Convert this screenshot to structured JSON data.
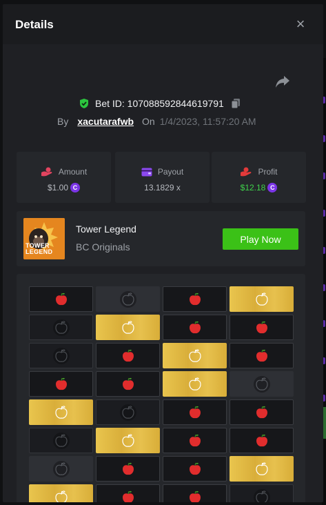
{
  "dialog": {
    "title": "Details",
    "close_glyph": "×"
  },
  "bet": {
    "id_text": "Bet ID: 107088592844619791",
    "by_label": "By",
    "username": "xacutarafwb",
    "on_label": "On",
    "datetime": "1/4/2023, 11:57:20 AM"
  },
  "stats": {
    "amount": {
      "label": "Amount",
      "value": "$1.00",
      "icon": "hand-coins-icon"
    },
    "payout": {
      "label": "Payout",
      "value": "13.1829 x",
      "icon": "wallet-icon"
    },
    "profit": {
      "label": "Profit",
      "value": "$12.18",
      "icon": "profit-hand-icon"
    }
  },
  "coin_glyph": "C",
  "game": {
    "thumbnail_text": "TOWER LEGEND",
    "name": "Tower Legend",
    "provider": "BC Originals",
    "play_label": "Play Now"
  },
  "colors": {
    "accent_green": "#3bc117",
    "coin_purple": "#7b35e6",
    "profit_green": "#3fd24b",
    "apple_red": "#e12d2d",
    "gold_tile": "#e3bc48"
  },
  "board": {
    "rows": [
      [
        "apple",
        "dark",
        "apple",
        "gold"
      ],
      [
        "unrevealed",
        "gold",
        "apple",
        "apple"
      ],
      [
        "unrevealed",
        "apple",
        "gold",
        "apple"
      ],
      [
        "apple",
        "apple",
        "gold",
        "dark"
      ],
      [
        "gold",
        "unrevealed",
        "apple",
        "apple"
      ],
      [
        "unrevealed",
        "gold",
        "apple",
        "apple"
      ],
      [
        "dark",
        "apple",
        "apple",
        "gold"
      ],
      [
        "gold",
        "apple",
        "apple",
        "unrevealed"
      ]
    ]
  }
}
